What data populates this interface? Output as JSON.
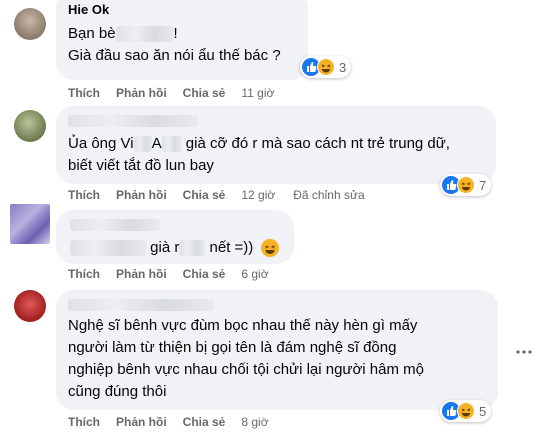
{
  "comments": [
    {
      "author": "Hie Ok",
      "lines": [
        "Bạn bè",
        "!",
        "Già đầu sao ăn nói ẩu thế bác ?"
      ],
      "actions": {
        "like": "Thích",
        "reply": "Phản hồi",
        "share": "Chia sẻ",
        "time": "11 giờ"
      },
      "reaction_count": "3"
    },
    {
      "lines": [
        "Ủa ông Vi",
        "A",
        "già cỡ đó r mà sao cách nt trẻ trung dữ,",
        "biết viết tắt đồ lun bay"
      ],
      "actions": {
        "like": "Thích",
        "reply": "Phản hồi",
        "share": "Chia sẻ",
        "time": "12 giờ",
        "edited": "Đã chỉnh sửa"
      },
      "reaction_count": "7"
    },
    {
      "lines": [
        "già r",
        "nết =))"
      ],
      "actions": {
        "like": "Thích",
        "reply": "Phản hồi",
        "share": "Chia sẻ",
        "time": "6 giờ"
      }
    },
    {
      "lines": [
        "Nghệ sĩ bênh vực đùm bọc nhau thế này hèn gì mấy",
        "người làm từ thiện bị gọi tên là đám nghệ sĩ đồng",
        "nghiệp bênh vực nhau chối tội chửi lại người hâm mộ",
        "cũng đúng thôi"
      ],
      "actions": {
        "like": "Thích",
        "reply": "Phản hồi",
        "share": "Chia sẻ",
        "time": "8 giờ"
      },
      "reaction_count": "5",
      "more_icon": "more-horizontal-icon"
    }
  ],
  "colors": {
    "bubble": "#f0f2f5",
    "like": "#1877f2",
    "haha": "#f7b125",
    "meta": "#65676b"
  }
}
